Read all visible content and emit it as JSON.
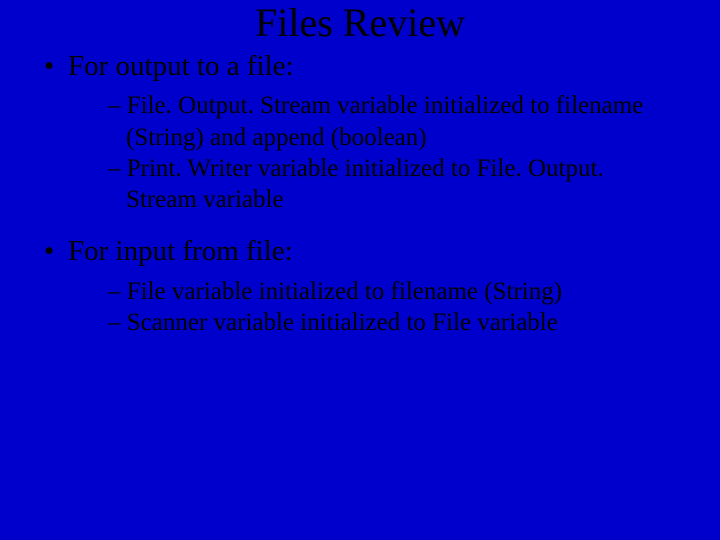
{
  "title": "Files Review",
  "bullets": [
    {
      "label": "For output to a file:",
      "subs": [
        "File. Output. Stream variable initialized to filename (String) and append (boolean)",
        "Print. Writer variable initialized to File. Output. Stream variable"
      ]
    },
    {
      "label": "For input from file:",
      "subs": [
        "File variable initialized to filename (String)",
        "Scanner variable initialized to File variable"
      ]
    }
  ]
}
